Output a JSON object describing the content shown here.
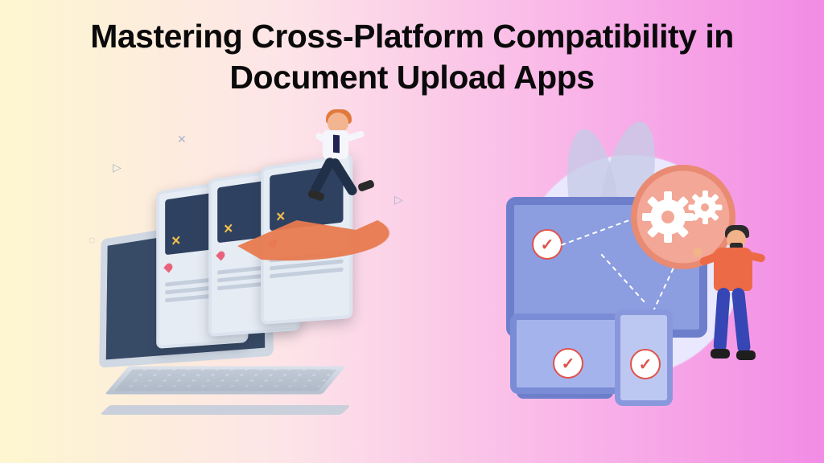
{
  "title_line1": "Mastering Cross-Platform Compatibility in",
  "title_line2": "Document Upload Apps",
  "checkmark_glyph": "✓",
  "x_glyph": "✕"
}
